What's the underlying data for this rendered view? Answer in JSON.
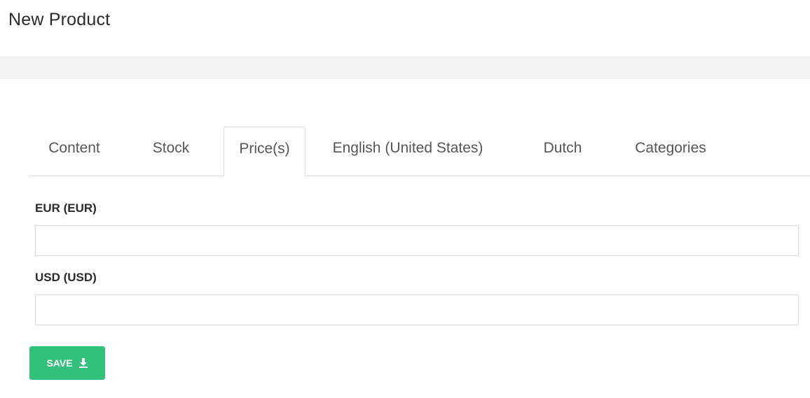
{
  "header": {
    "title": "New Product"
  },
  "tabs": [
    {
      "label": "Content",
      "active": false
    },
    {
      "label": "Stock",
      "active": false
    },
    {
      "label": "Price(s)",
      "active": true
    },
    {
      "label": "English (United States)",
      "active": false
    },
    {
      "label": "Dutch",
      "active": false
    },
    {
      "label": "Categories",
      "active": false
    }
  ],
  "form": {
    "fields": [
      {
        "label": "EUR (EUR)",
        "value": "",
        "placeholder": ""
      },
      {
        "label": "USD (USD)",
        "value": "",
        "placeholder": ""
      }
    ],
    "save_label": "SAVE",
    "save_icon": "download-icon"
  },
  "colors": {
    "save_button": "#33c07c",
    "band": "#f3f3f4"
  }
}
